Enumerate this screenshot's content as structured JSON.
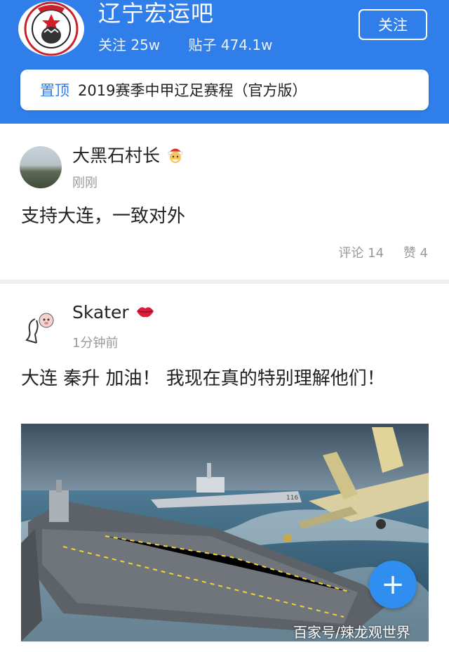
{
  "header": {
    "forum_name": "辽宁宏运吧",
    "follow_count": "关注 25w",
    "post_count": "贴子 474.1w",
    "follow_button": "关注",
    "accent_color": "#2f7ee9"
  },
  "pinned": {
    "tag": "置顶",
    "title": "2019赛季中甲辽足赛程（官方版）"
  },
  "posts": [
    {
      "username": "大黑石村长",
      "badge_icon": "santa-emoji-icon",
      "time": "刚刚",
      "content": "支持大连，一致对外",
      "comments": "评论 14",
      "likes": "赞 4"
    },
    {
      "username": "Skater",
      "badge_icon": "lips-icon",
      "time": "1分钟前",
      "content": "大连 秦升 加油！ 我现在真的特别理解他们！",
      "image_icon": "aircraft-carrier-image"
    }
  ],
  "fab_icon": "plus-icon",
  "watermark": "百家号/辣龙观世界"
}
